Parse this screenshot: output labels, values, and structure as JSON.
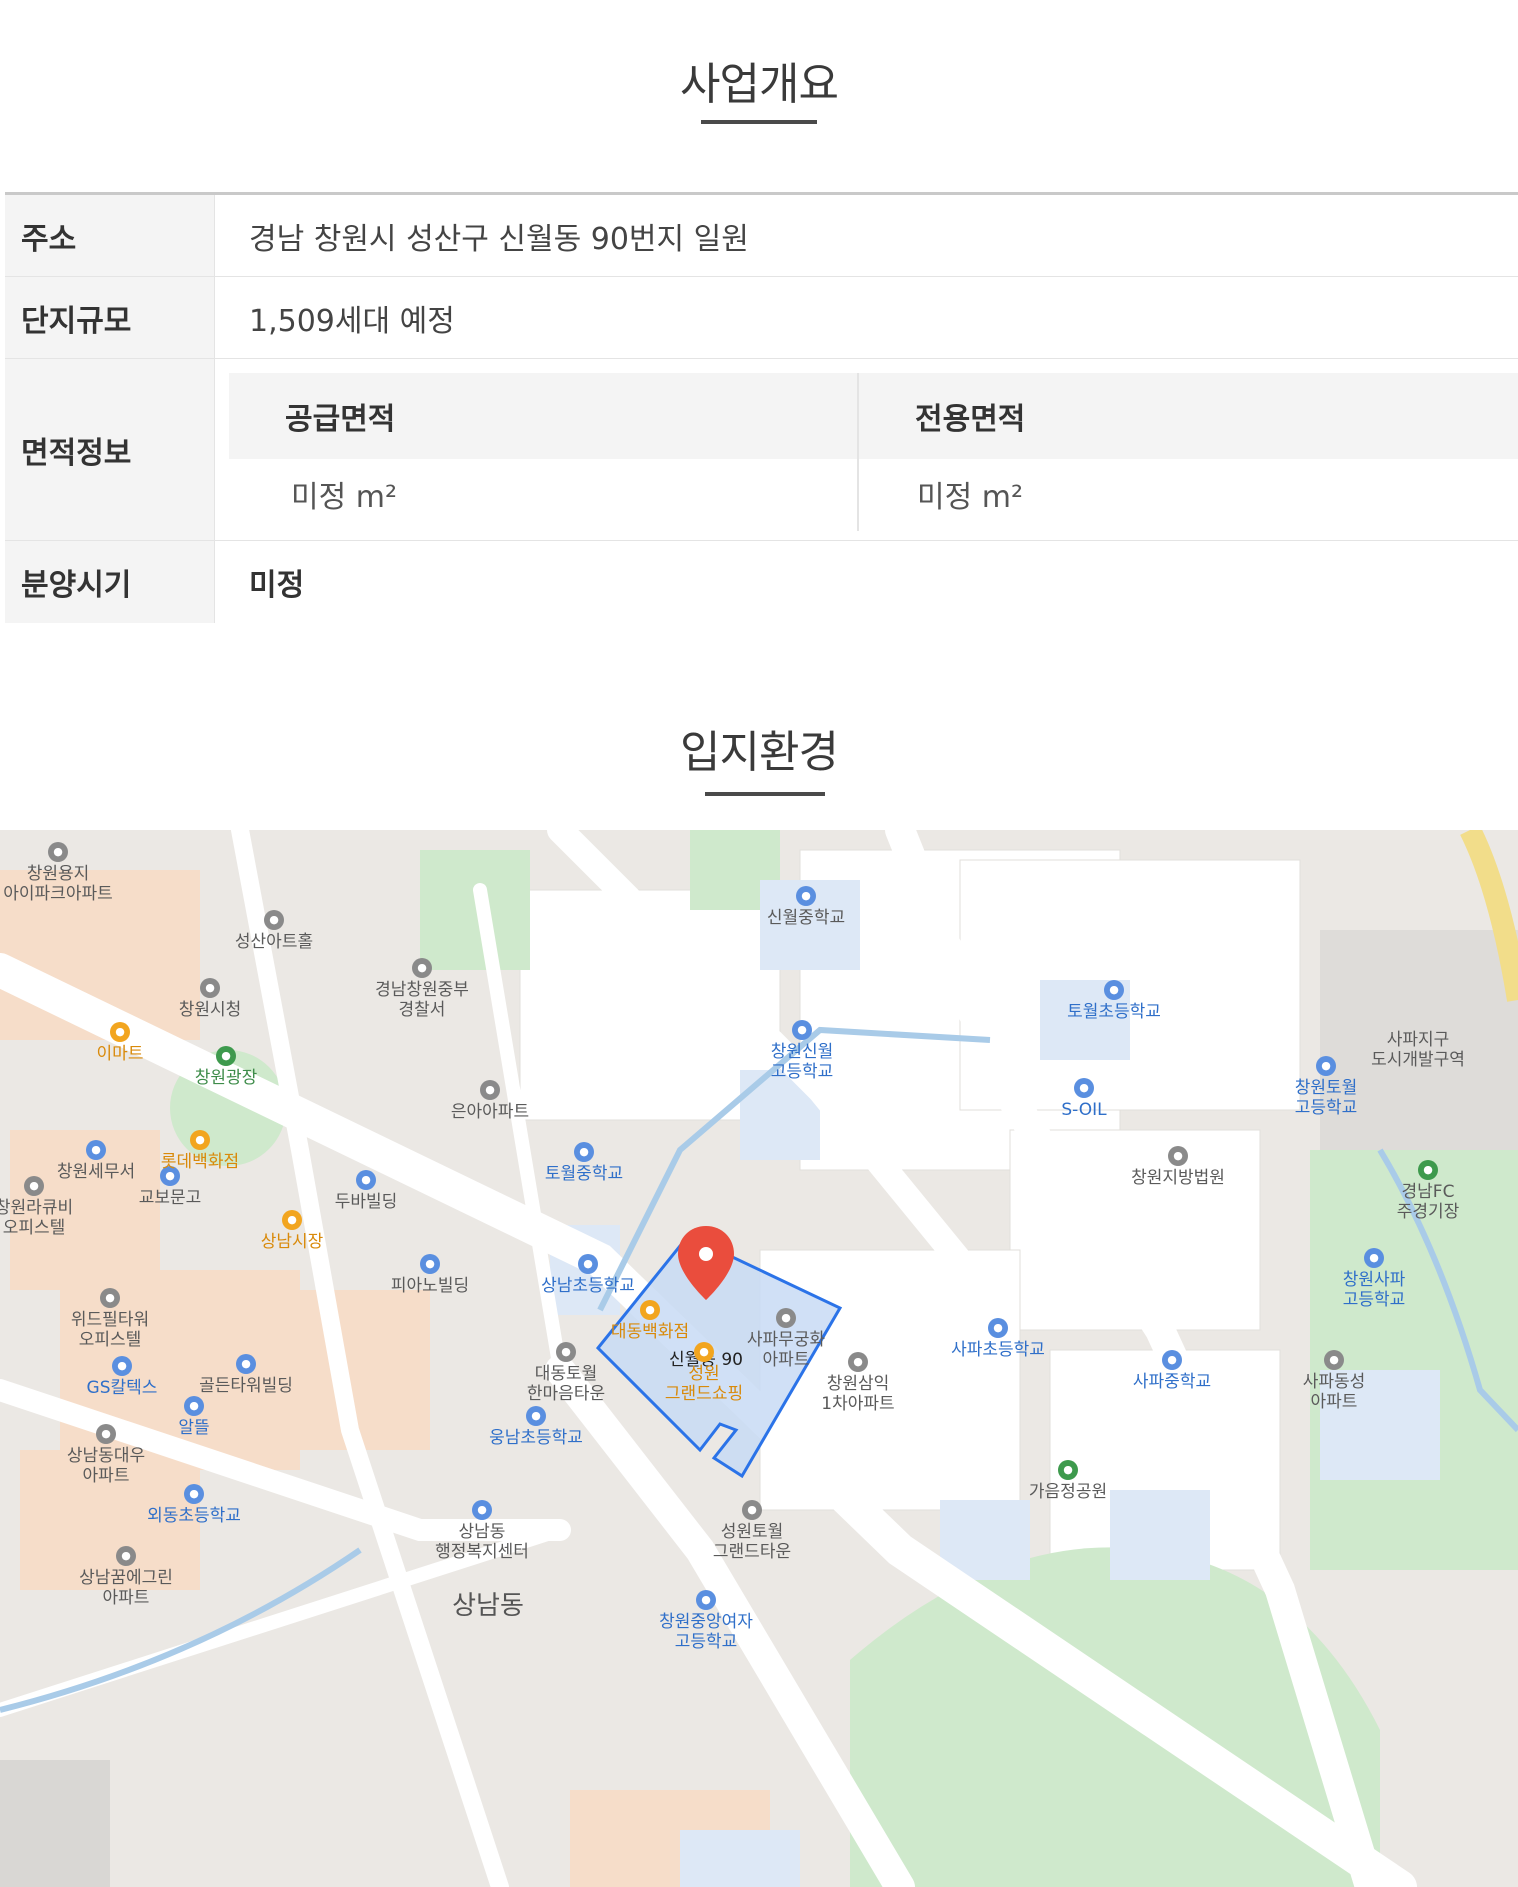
{
  "overview": {
    "title": "사업개요",
    "rows": {
      "address": {
        "label": "주소",
        "value": "경남 창원시 성산구 신월동 90번지 일원"
      },
      "scale": {
        "label": "단지규모",
        "value": "1,509세대 예정"
      },
      "area": {
        "label": "면적정보",
        "supply_label": "공급면적",
        "supply_value": "미정 m²",
        "exclusive_label": "전용면적",
        "exclusive_value": "미정 m²"
      },
      "sale": {
        "label": "분양시기",
        "value": "미정"
      }
    }
  },
  "location": {
    "title": "입지환경",
    "map": {
      "target_label": "신월동 90",
      "district_label": "상남동",
      "labels": {
        "l1": "창원용지\n아이파크아파트",
        "l2": "성산아트홀",
        "l3": "경남창원중부\n경찰서",
        "l4": "신월중학교",
        "l5": "창원시청",
        "l6": "이마트",
        "l7": "창원광장",
        "l8": "토월초등학교",
        "l9": "사파지구\n도시개발구역",
        "l10": "창원신월\n고등학교",
        "l11": "은아아파트",
        "l12": "S-OIL",
        "l13": "창원토월\n고등학교",
        "l14": "롯데백화점",
        "l15": "창원세무서",
        "l16": "토월중학교",
        "l17": "창원지방법원",
        "l18": "경남FC\n주경기장",
        "l19": "창원라큐비\n오피스텔",
        "l20": "교보문고",
        "l21": "두바빌딩",
        "l22": "상남시장",
        "l23": "피아노빌딩",
        "l24": "상남초등학교",
        "l25": "위드필타워\n오피스텔",
        "l26": "대동백화점",
        "l27": "사파무궁화\n아파트",
        "l28": "사파초등학교",
        "l29": "창원사파\n고등학교",
        "l30": "GS칼텍스",
        "l31": "골든타워빌딩",
        "l32": "대동토월\n한마음타운",
        "l33": "성원\n그랜드쇼핑",
        "l34": "창원삼익\n1차아파트",
        "l35": "사파중학교",
        "l36": "사파동성\n아파트",
        "l37": "알뜰",
        "l38": "웅남초등학교",
        "l39": "상남동대우\n아파트",
        "l40": "가음정공원",
        "l41": "외동초등학교",
        "l42": "상남동\n행정복지센터",
        "l43": "성원토월\n그랜드타운",
        "l44": "상남꿈에그린\n아파트",
        "l45": "창원중앙여자\n고등학교"
      }
    }
  }
}
